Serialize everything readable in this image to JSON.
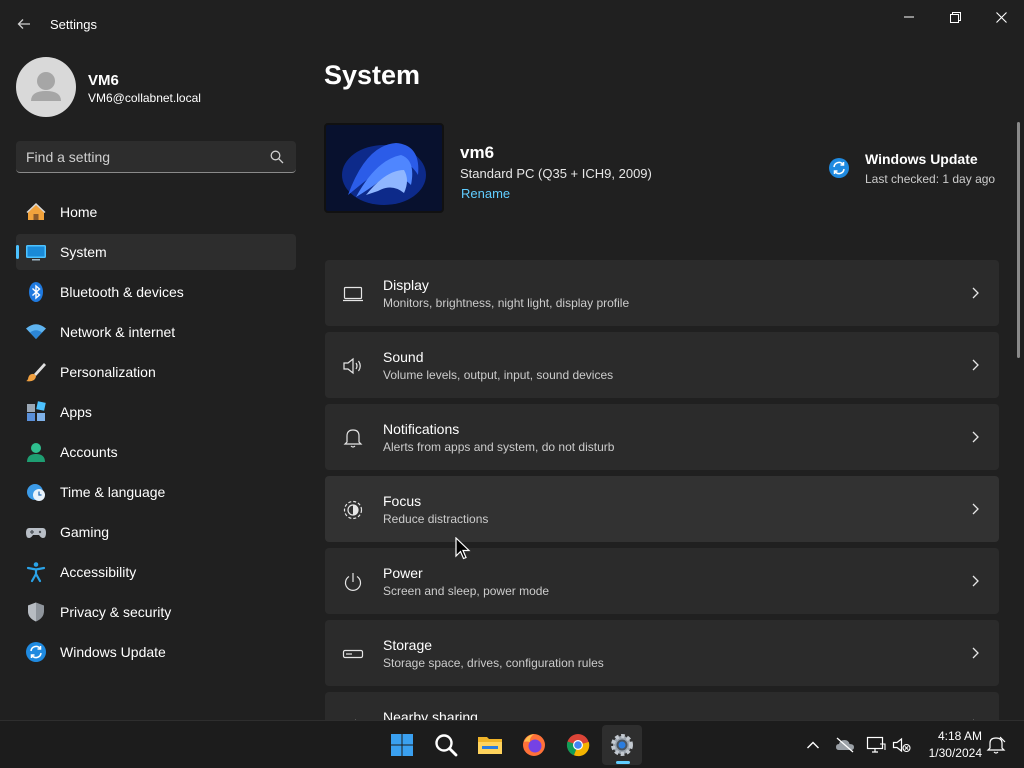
{
  "window": {
    "title": "Settings",
    "controls": {
      "minimize": "minimize",
      "maximize": "restore",
      "close": "close"
    }
  },
  "user": {
    "name": "VM6",
    "email": "VM6@collabnet.local"
  },
  "search": {
    "placeholder": "Find a setting"
  },
  "sidebar": {
    "items": [
      {
        "label": "Home",
        "icon": "home-icon",
        "active": false
      },
      {
        "label": "System",
        "icon": "system-icon",
        "active": true
      },
      {
        "label": "Bluetooth & devices",
        "icon": "bluetooth-icon",
        "active": false
      },
      {
        "label": "Network & internet",
        "icon": "wifi-icon",
        "active": false
      },
      {
        "label": "Personalization",
        "icon": "brush-icon",
        "active": false
      },
      {
        "label": "Apps",
        "icon": "apps-icon",
        "active": false
      },
      {
        "label": "Accounts",
        "icon": "person-icon",
        "active": false
      },
      {
        "label": "Time & language",
        "icon": "globe-clock-icon",
        "active": false
      },
      {
        "label": "Gaming",
        "icon": "gamepad-icon",
        "active": false
      },
      {
        "label": "Accessibility",
        "icon": "accessibility-icon",
        "active": false
      },
      {
        "label": "Privacy & security",
        "icon": "shield-icon",
        "active": false
      },
      {
        "label": "Windows Update",
        "icon": "update-icon",
        "active": false
      }
    ]
  },
  "main": {
    "title": "System",
    "device": {
      "name": "vm6",
      "model": "Standard PC (Q35 + ICH9, 2009)",
      "rename_label": "Rename"
    },
    "windows_update": {
      "title": "Windows Update",
      "status": "Last checked: 1 day ago"
    },
    "cards": [
      {
        "title": "Display",
        "subtitle": "Monitors, brightness, night light, display profile",
        "icon": "monitor-icon"
      },
      {
        "title": "Sound",
        "subtitle": "Volume levels, output, input, sound devices",
        "icon": "speaker-icon"
      },
      {
        "title": "Notifications",
        "subtitle": "Alerts from apps and system, do not disturb",
        "icon": "bell-icon"
      },
      {
        "title": "Focus",
        "subtitle": "Reduce distractions",
        "icon": "focus-icon"
      },
      {
        "title": "Power",
        "subtitle": "Screen and sleep, power mode",
        "icon": "power-icon"
      },
      {
        "title": "Storage",
        "subtitle": "Storage space, drives, configuration rules",
        "icon": "storage-icon"
      },
      {
        "title": "Nearby sharing",
        "subtitle": "",
        "icon": "share-icon"
      }
    ]
  },
  "taskbar": {
    "apps": [
      "start-icon",
      "search-icon",
      "file-explorer-icon",
      "firefox-icon",
      "chrome-icon",
      "settings-icon"
    ],
    "active_app": "settings-icon",
    "clock": {
      "time": "4:18 AM",
      "date": "1/30/2024"
    }
  },
  "colors": {
    "background": "#202020",
    "card": "#2b2b2b",
    "accent": "#60cdff",
    "sidebar_active": "#2d2d2d"
  }
}
